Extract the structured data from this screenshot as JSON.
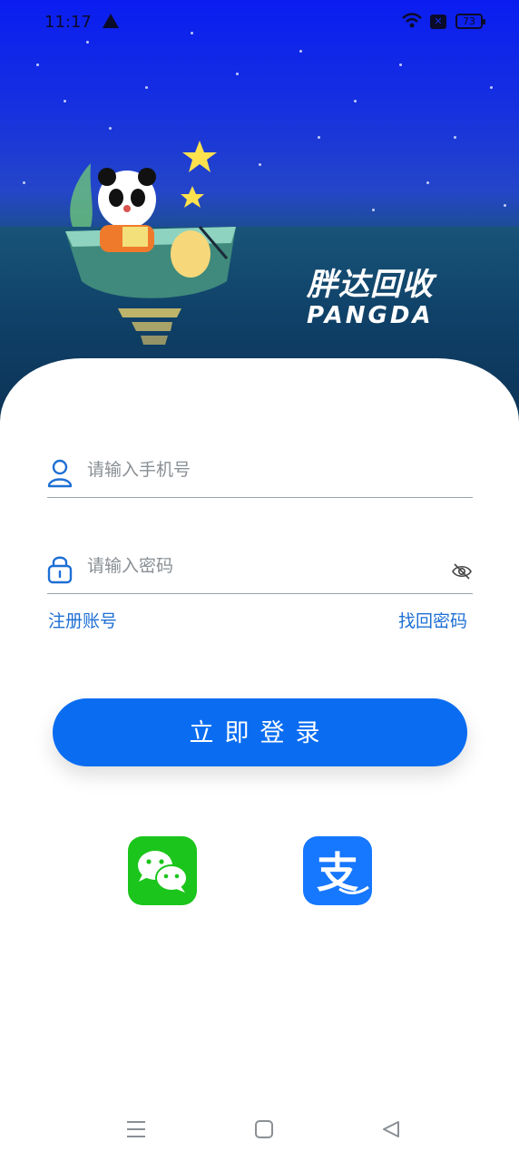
{
  "status_bar": {
    "time": "11:17",
    "battery_level": "73",
    "icons": [
      "warning-icon",
      "wifi-icon",
      "sim-icon",
      "battery-icon"
    ]
  },
  "banner": {
    "brand_cn": "胖达回收",
    "brand_en": "PANGDA",
    "illustration": "panda-in-boat-illustration"
  },
  "form": {
    "phone_placeholder": "请输入手机号",
    "password_placeholder": "请输入密码",
    "register_link": "注册账号",
    "forgot_link": "找回密码",
    "login_button": "立即登录"
  },
  "social_login": [
    {
      "name": "wechat",
      "icon": "wechat-icon",
      "color": "#1bc51b"
    },
    {
      "name": "alipay",
      "icon": "alipay-icon",
      "color": "#1677ff"
    }
  ],
  "navigation": [
    "menu-icon",
    "home-icon",
    "back-icon"
  ],
  "colors": {
    "primary": "#0a6df1",
    "link": "#1d6fd4",
    "banner_top": "#0a1df0",
    "sea": "#0f3f66"
  }
}
